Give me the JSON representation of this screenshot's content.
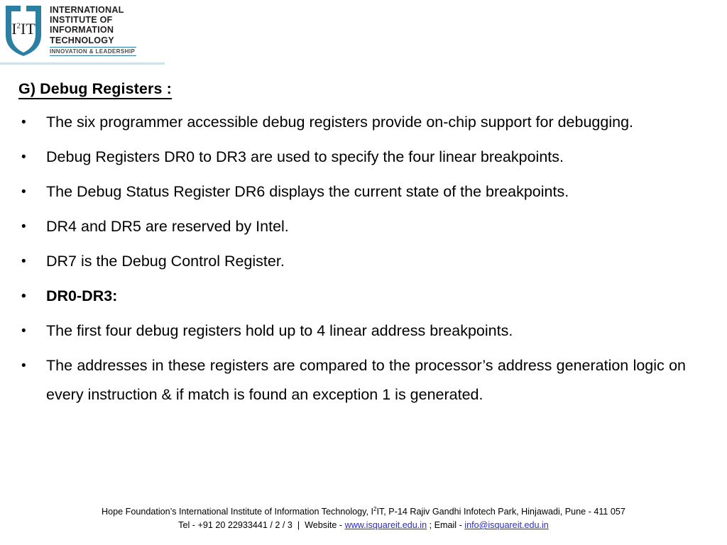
{
  "logo": {
    "shield_text_main": "I",
    "shield_text_sup": "2",
    "shield_text_tail": "IT",
    "words": [
      "INTERNATIONAL",
      "INSTITUTE OF",
      "INFORMATION",
      "TECHNOLOGY"
    ],
    "tagline": "INNOVATION & LEADERSHIP",
    "accent_color": "#2b7fa3",
    "rule_color": "#cfe3ea"
  },
  "slide": {
    "title": "G) Debug Registers :",
    "bullets": [
      "The six programmer accessible debug registers provide on-chip support for debugging.",
      "Debug Registers DR0 to DR3 are used to specify the four linear breakpoints.",
      "The Debug Status Register DR6 displays the current state of the breakpoints.",
      "DR4 and DR5 are reserved by Intel.",
      "DR7 is the  Debug Control Register.",
      "DR0-DR3:",
      "The first four debug registers hold up to 4 linear address breakpoints.",
      "The addresses in these registers are compared to the processor’s address generation logic on every instruction & if match is found an exception 1 is generated."
    ]
  },
  "footer": {
    "line1_pre": "Hope Foundation’s International Institute of Information Technology, I",
    "line1_sup": "2",
    "line1_post": "IT, P-14 Rajiv Gandhi Infotech Park, Hinjawadi, Pune - 411 057",
    "line2_tel": "Tel - +91 20 22933441 / 2 / 3  |  Website - ",
    "website": "www.isquareit.edu.in",
    "line2_mid": " ; Email - ",
    "email": "info@isquareit.edu.in",
    "link_color": "#2a2ad0"
  }
}
